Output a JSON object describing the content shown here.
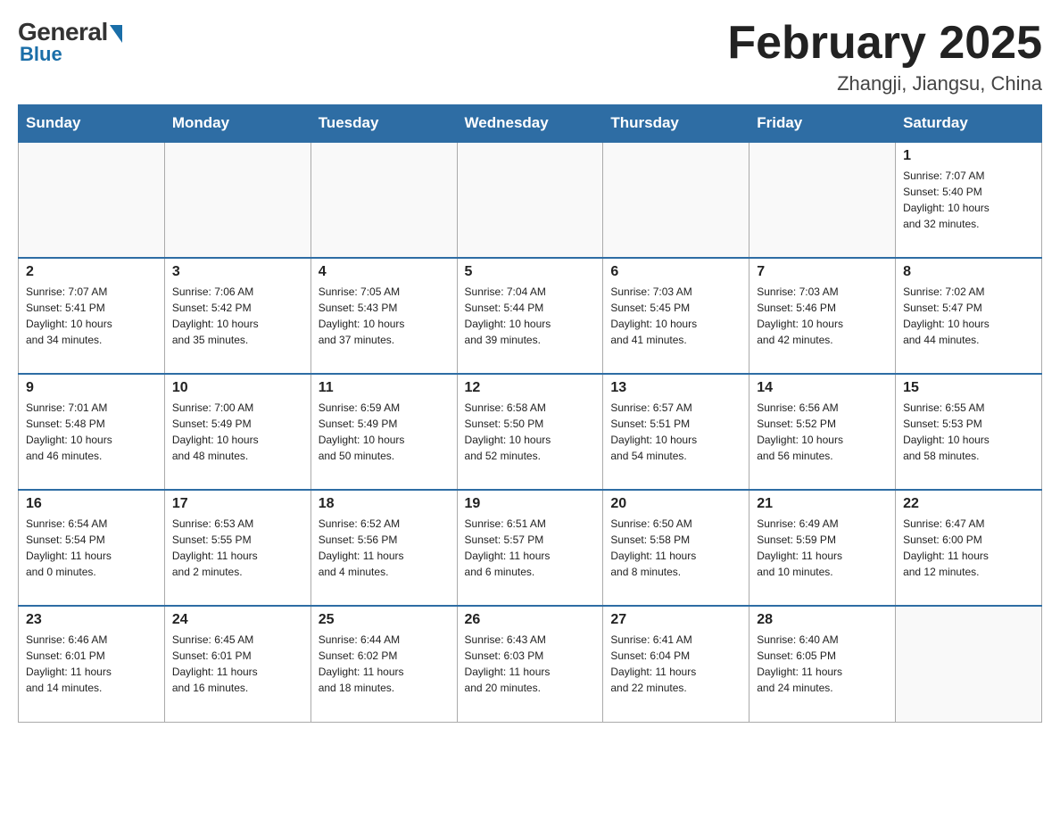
{
  "logo": {
    "general": "General",
    "blue": "Blue"
  },
  "title": "February 2025",
  "location": "Zhangji, Jiangsu, China",
  "weekdays": [
    "Sunday",
    "Monday",
    "Tuesday",
    "Wednesday",
    "Thursday",
    "Friday",
    "Saturday"
  ],
  "weeks": [
    [
      {
        "day": "",
        "info": ""
      },
      {
        "day": "",
        "info": ""
      },
      {
        "day": "",
        "info": ""
      },
      {
        "day": "",
        "info": ""
      },
      {
        "day": "",
        "info": ""
      },
      {
        "day": "",
        "info": ""
      },
      {
        "day": "1",
        "info": "Sunrise: 7:07 AM\nSunset: 5:40 PM\nDaylight: 10 hours\nand 32 minutes."
      }
    ],
    [
      {
        "day": "2",
        "info": "Sunrise: 7:07 AM\nSunset: 5:41 PM\nDaylight: 10 hours\nand 34 minutes."
      },
      {
        "day": "3",
        "info": "Sunrise: 7:06 AM\nSunset: 5:42 PM\nDaylight: 10 hours\nand 35 minutes."
      },
      {
        "day": "4",
        "info": "Sunrise: 7:05 AM\nSunset: 5:43 PM\nDaylight: 10 hours\nand 37 minutes."
      },
      {
        "day": "5",
        "info": "Sunrise: 7:04 AM\nSunset: 5:44 PM\nDaylight: 10 hours\nand 39 minutes."
      },
      {
        "day": "6",
        "info": "Sunrise: 7:03 AM\nSunset: 5:45 PM\nDaylight: 10 hours\nand 41 minutes."
      },
      {
        "day": "7",
        "info": "Sunrise: 7:03 AM\nSunset: 5:46 PM\nDaylight: 10 hours\nand 42 minutes."
      },
      {
        "day": "8",
        "info": "Sunrise: 7:02 AM\nSunset: 5:47 PM\nDaylight: 10 hours\nand 44 minutes."
      }
    ],
    [
      {
        "day": "9",
        "info": "Sunrise: 7:01 AM\nSunset: 5:48 PM\nDaylight: 10 hours\nand 46 minutes."
      },
      {
        "day": "10",
        "info": "Sunrise: 7:00 AM\nSunset: 5:49 PM\nDaylight: 10 hours\nand 48 minutes."
      },
      {
        "day": "11",
        "info": "Sunrise: 6:59 AM\nSunset: 5:49 PM\nDaylight: 10 hours\nand 50 minutes."
      },
      {
        "day": "12",
        "info": "Sunrise: 6:58 AM\nSunset: 5:50 PM\nDaylight: 10 hours\nand 52 minutes."
      },
      {
        "day": "13",
        "info": "Sunrise: 6:57 AM\nSunset: 5:51 PM\nDaylight: 10 hours\nand 54 minutes."
      },
      {
        "day": "14",
        "info": "Sunrise: 6:56 AM\nSunset: 5:52 PM\nDaylight: 10 hours\nand 56 minutes."
      },
      {
        "day": "15",
        "info": "Sunrise: 6:55 AM\nSunset: 5:53 PM\nDaylight: 10 hours\nand 58 minutes."
      }
    ],
    [
      {
        "day": "16",
        "info": "Sunrise: 6:54 AM\nSunset: 5:54 PM\nDaylight: 11 hours\nand 0 minutes."
      },
      {
        "day": "17",
        "info": "Sunrise: 6:53 AM\nSunset: 5:55 PM\nDaylight: 11 hours\nand 2 minutes."
      },
      {
        "day": "18",
        "info": "Sunrise: 6:52 AM\nSunset: 5:56 PM\nDaylight: 11 hours\nand 4 minutes."
      },
      {
        "day": "19",
        "info": "Sunrise: 6:51 AM\nSunset: 5:57 PM\nDaylight: 11 hours\nand 6 minutes."
      },
      {
        "day": "20",
        "info": "Sunrise: 6:50 AM\nSunset: 5:58 PM\nDaylight: 11 hours\nand 8 minutes."
      },
      {
        "day": "21",
        "info": "Sunrise: 6:49 AM\nSunset: 5:59 PM\nDaylight: 11 hours\nand 10 minutes."
      },
      {
        "day": "22",
        "info": "Sunrise: 6:47 AM\nSunset: 6:00 PM\nDaylight: 11 hours\nand 12 minutes."
      }
    ],
    [
      {
        "day": "23",
        "info": "Sunrise: 6:46 AM\nSunset: 6:01 PM\nDaylight: 11 hours\nand 14 minutes."
      },
      {
        "day": "24",
        "info": "Sunrise: 6:45 AM\nSunset: 6:01 PM\nDaylight: 11 hours\nand 16 minutes."
      },
      {
        "day": "25",
        "info": "Sunrise: 6:44 AM\nSunset: 6:02 PM\nDaylight: 11 hours\nand 18 minutes."
      },
      {
        "day": "26",
        "info": "Sunrise: 6:43 AM\nSunset: 6:03 PM\nDaylight: 11 hours\nand 20 minutes."
      },
      {
        "day": "27",
        "info": "Sunrise: 6:41 AM\nSunset: 6:04 PM\nDaylight: 11 hours\nand 22 minutes."
      },
      {
        "day": "28",
        "info": "Sunrise: 6:40 AM\nSunset: 6:05 PM\nDaylight: 11 hours\nand 24 minutes."
      },
      {
        "day": "",
        "info": ""
      }
    ]
  ],
  "colors": {
    "header_bg": "#2e6da4",
    "header_text": "#ffffff",
    "accent": "#1a6ea8"
  }
}
